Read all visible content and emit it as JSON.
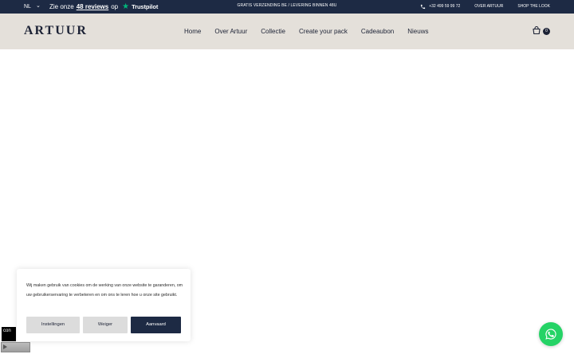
{
  "topbar": {
    "language": "NL",
    "reviews_prefix": "Zie onze",
    "reviews_count": "48",
    "reviews_word": "reviews",
    "reviews_suffix": "op",
    "trustpilot_brand": "Trustpilot",
    "promo": "GRATIS VERZENDING BE / LEVERING BINNEN 48U",
    "phone": "+32 499 59 99 72",
    "link_over": "OVER ARTUUR",
    "link_shop": "SHOP THE LOOK"
  },
  "header": {
    "logo": "ARTUUR",
    "nav": [
      "Home",
      "Over Artuur",
      "Collectie",
      "Create your pack",
      "Cadeaubon",
      "Nieuws"
    ],
    "cart_count": "0"
  },
  "cookie": {
    "text": "Wij maken gebruik van cookies om de werking van onze website te garanderen, om uw gebruikerservaring te verbeteren en om ons te leren hoe u onze site gebruikt.",
    "settings": "Instellingen",
    "decline": "Weiger",
    "accept": "Aanvaard"
  },
  "overlay": {
    "label": "con"
  },
  "colors": {
    "topbar_bg": "#1d2a44",
    "header_bg": "#e4e0da",
    "accent": "#1d2a44",
    "whatsapp": "#25d366",
    "trustpilot": "#00b67a"
  }
}
